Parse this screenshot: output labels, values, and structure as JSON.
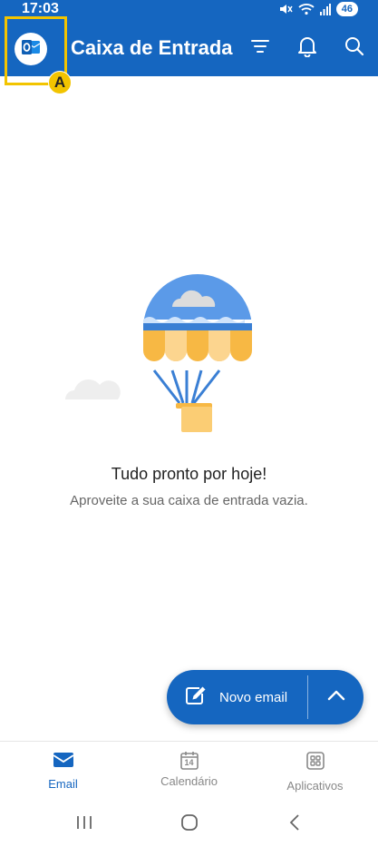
{
  "status_bar": {
    "time": "17:03",
    "battery_level": "46",
    "icons": [
      "mute-icon",
      "wifi-icon",
      "signal-icon",
      "battery-icon"
    ]
  },
  "app_bar": {
    "title": "Caixa de Entrada",
    "account_icon": "outlook-icon",
    "actions": [
      "filter-icon",
      "bell-icon",
      "search-icon"
    ],
    "annotation_marker": "A"
  },
  "empty_state": {
    "title": "Tudo pronto por hoje!",
    "subtitle": "Aproveite a sua caixa de entrada vazia."
  },
  "fab": {
    "label": "Novo email",
    "icon": "compose-icon",
    "expand_icon": "chevron-up-icon"
  },
  "bottom_nav": {
    "items": [
      {
        "label": "Email",
        "icon": "email-icon",
        "active": true
      },
      {
        "label": "Calendário",
        "icon": "calendar-icon",
        "day": "14",
        "active": false
      },
      {
        "label": "Aplicativos",
        "icon": "apps-icon",
        "active": false
      }
    ]
  },
  "system_nav": [
    "recents-icon",
    "home-icon",
    "back-icon"
  ],
  "colors": {
    "primary": "#1566c0",
    "highlight": "#f2c400",
    "balloon_blue": "#5b9ae8",
    "balloon_orange": "#f7b844"
  }
}
